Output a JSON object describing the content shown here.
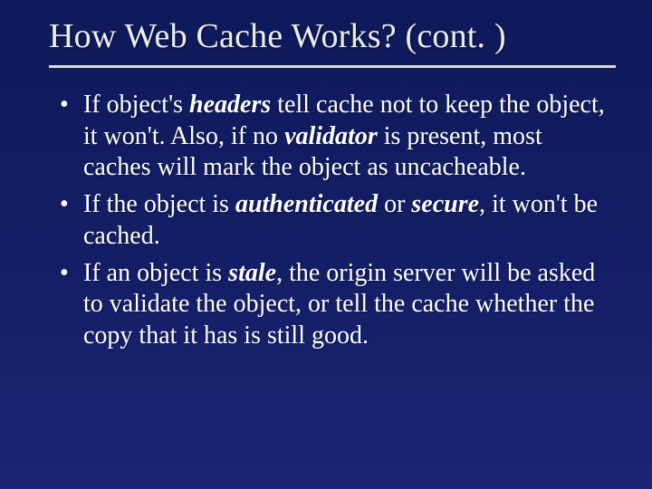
{
  "slide": {
    "title": "How Web Cache Works? (cont. )",
    "bullets": [
      {
        "parts": [
          {
            "t": "If object's "
          },
          {
            "t": "headers",
            "em": true
          },
          {
            "t": " tell cache not to keep the object, it won't. Also, if no "
          },
          {
            "t": "validator",
            "em": true
          },
          {
            "t": " is present, most caches will mark the object as uncacheable."
          }
        ]
      },
      {
        "parts": [
          {
            "t": "If the object is "
          },
          {
            "t": "authenticated",
            "em": true
          },
          {
            "t": " or "
          },
          {
            "t": "secure",
            "em": true
          },
          {
            "t": ", it won't be cached."
          }
        ]
      },
      {
        "parts": [
          {
            "t": "If an object is "
          },
          {
            "t": "stale",
            "em": true
          },
          {
            "t": ", the origin server will be asked to validate the object, or tell the cache whether the copy that it has is still good."
          }
        ]
      }
    ]
  }
}
